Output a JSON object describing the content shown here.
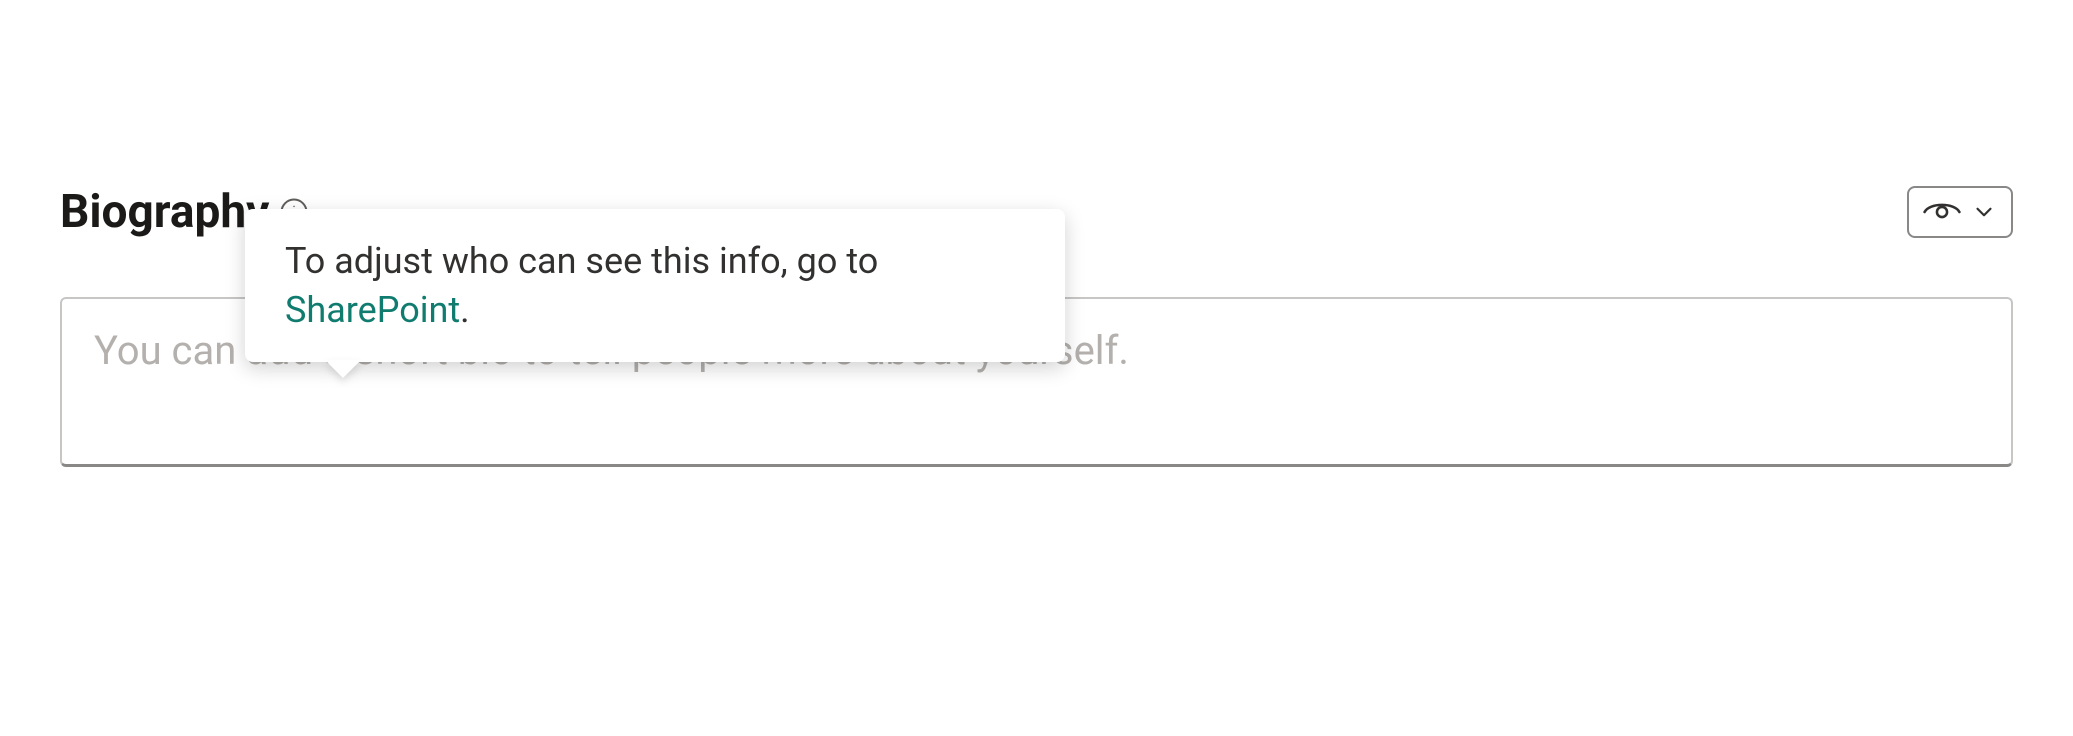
{
  "tooltip": {
    "text_before": "To adjust who can see this info, go to ",
    "link_label": "SharePoint",
    "text_after": "."
  },
  "biography": {
    "label": "Biography",
    "placeholder": "You can add a short bio to tell people more about yourself.",
    "value": ""
  },
  "icons": {
    "info": "info-icon",
    "visibility": "eye-icon",
    "chevron": "chevron-down-icon"
  }
}
